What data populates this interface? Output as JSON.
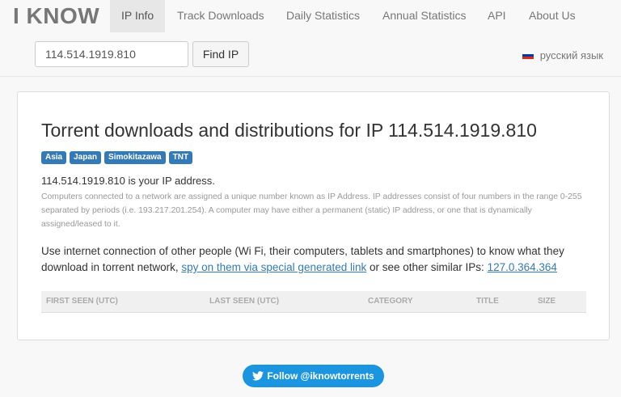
{
  "brand": "I KNOW",
  "nav": {
    "items": [
      {
        "label": "IP Info",
        "active": true
      },
      {
        "label": "Track Downloads",
        "active": false
      },
      {
        "label": "Daily Statistics",
        "active": false
      },
      {
        "label": "Annual Statistics",
        "active": false
      },
      {
        "label": "API",
        "active": false
      },
      {
        "label": "About Us",
        "active": false
      }
    ]
  },
  "search": {
    "value": "114.514.1919.810",
    "button_label": "Find IP"
  },
  "language": {
    "label": "русский язык",
    "flag_colors": [
      "#ffffff",
      "#0039a6",
      "#d52b1e"
    ]
  },
  "main": {
    "title": "Torrent downloads and distributions for IP 114.514.1919.810",
    "tags": [
      "Asia",
      "Japan",
      "Simokitazawa",
      "TNT"
    ],
    "tag_color": "#337ab7",
    "your_ip": "114.514.1919.810 is your IP address.",
    "explanation": "Computers connected to a network are assigned a unique number known as IP Address. IP addresses consist of four numbers in the range 0-255 separated by periods (i.e. 193.217.201.254). A computer may have either a permanent (static) IP address, or one that is dynamically assigned/leased to it.",
    "use_text_before": "Use internet connection of other people (Wi Fi, their computers, tablets and smartphones) to know what they download in torrent network, ",
    "spy_link": "spy on them via special generated link",
    "use_text_middle": " or see other similar IPs: ",
    "similar_ip_link": "127.0.364.364",
    "table_headers": [
      "FIRST SEEN (UTC)",
      "LAST SEEN (UTC)",
      "CATEGORY",
      "TITLE",
      "SIZE"
    ]
  },
  "footer": {
    "follow_label": "Follow @iknowtorrents",
    "follow_icon": "twitter-bird-icon",
    "follow_color": "#1b95e0"
  }
}
